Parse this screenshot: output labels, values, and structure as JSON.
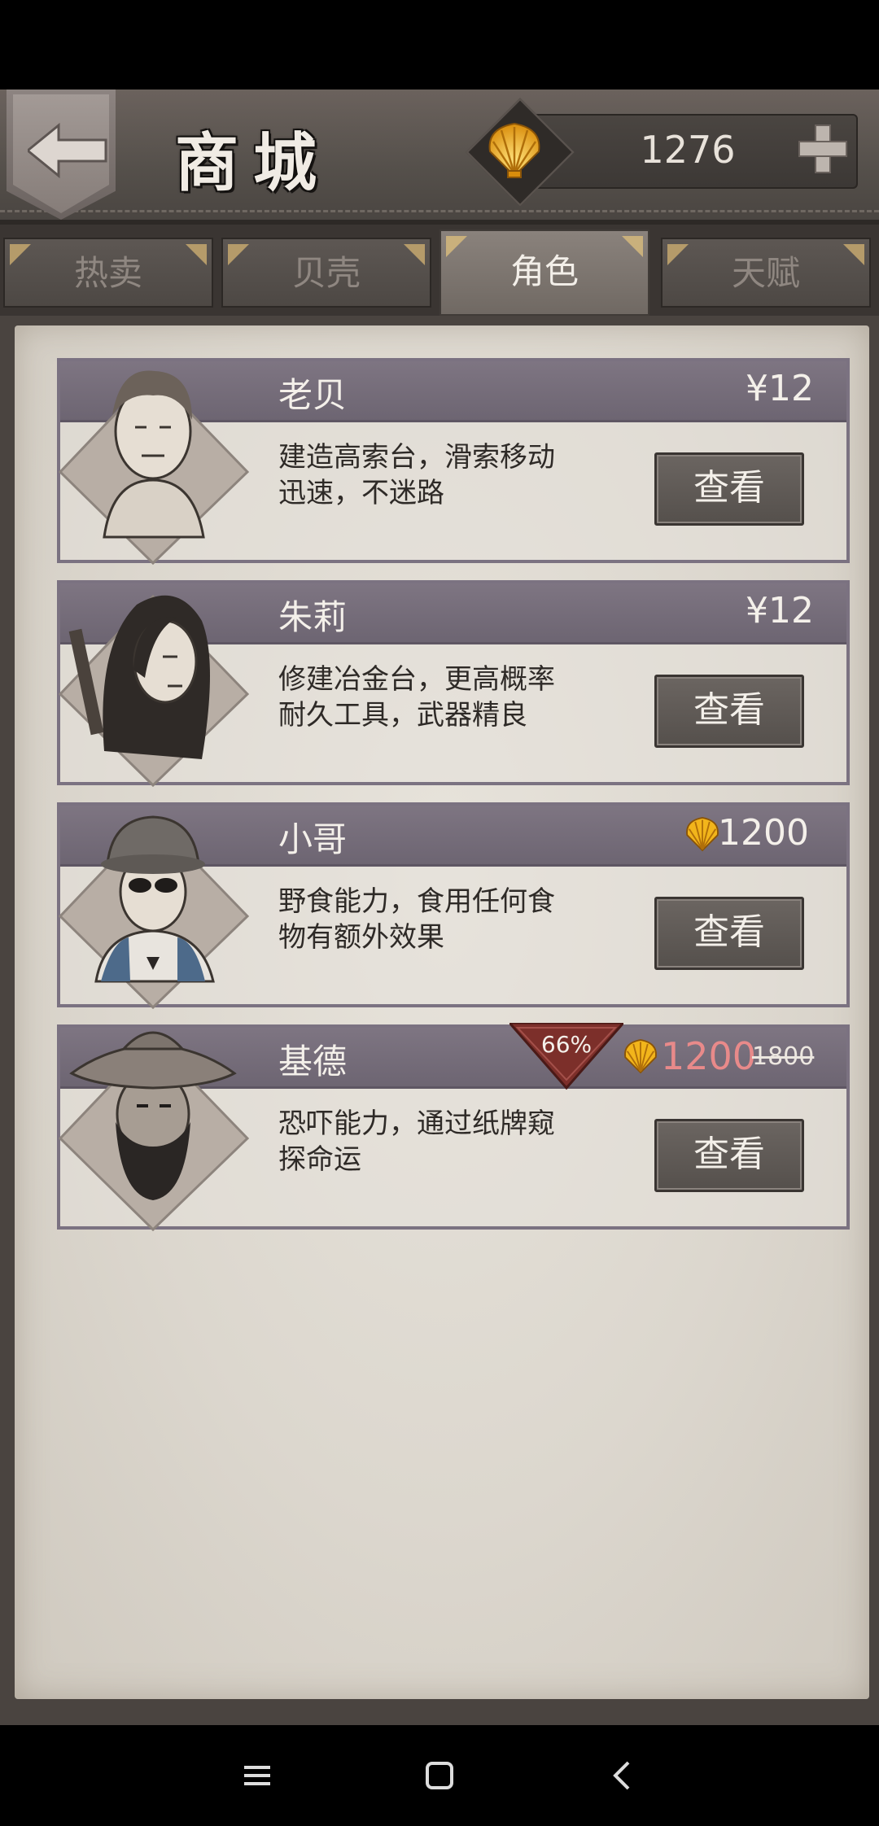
{
  "header": {
    "title": "商城",
    "currency_value": "1276"
  },
  "tabs": [
    {
      "label": "热卖",
      "active": false
    },
    {
      "label": "贝壳",
      "active": false
    },
    {
      "label": "角色",
      "active": true
    },
    {
      "label": "天赋",
      "active": false
    }
  ],
  "characters": [
    {
      "name": "老贝",
      "price": "¥12",
      "description": "建造高索台，滑索移动迅速，不迷路",
      "button": "查看"
    },
    {
      "name": "朱莉",
      "price": "¥12",
      "description": "修建冶金台，更高概率耐久工具，武器精良",
      "button": "查看"
    },
    {
      "name": "小哥",
      "price": "1200",
      "price_type": "shell",
      "description": "野食能力，食用任何食物有额外效果",
      "button": "查看"
    },
    {
      "name": "基德",
      "price": "1200",
      "old_price": "1800",
      "discount": "66%",
      "price_type": "shell",
      "description": "恐吓能力，通过纸牌窥探命运",
      "button": "查看"
    }
  ],
  "colors": {
    "card_header": "#7e7582",
    "discount_price": "#e88a8a",
    "shell_gold": "#f2b51b"
  },
  "icons": [
    "back-arrow-icon",
    "shell-icon",
    "plus-icon",
    "menu-icon",
    "home-icon",
    "back-icon"
  ]
}
